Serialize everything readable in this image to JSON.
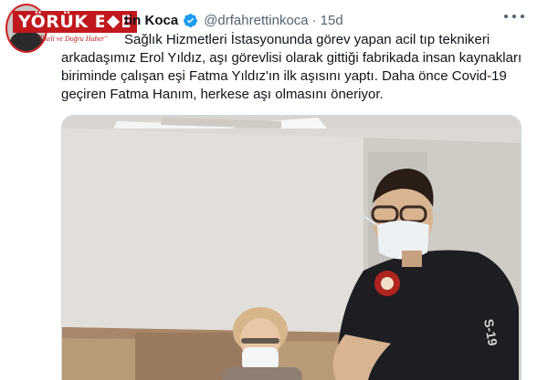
{
  "tweet": {
    "author_name": "tin Koca",
    "handle": "@drfahrettinkoca",
    "separator": "·",
    "time": "15d",
    "text_lines": [
      "Sağlık Hizmetleri İstasyonunda görev yapan acil tıp teknikeri",
      "arkadaşımız Erol Yıldız, aşı görevlisi olarak gittiği fabrikada insan kaynakları",
      "biriminde çalışan eşi Fatma Yıldız'ın ilk aşısını yaptı. Daha önce Covid-19",
      "geçiren Fatma Hanım, herkese aşı olmasını öneriyor."
    ],
    "verified_icon": "verified-badge-icon",
    "more_icon": "more-options-icon"
  },
  "watermark": {
    "title": "YÖRÜK EFE",
    "slogan": "\"İlkeli ve Doğru Haber\""
  },
  "colors": {
    "verified": "#1d9bf0",
    "secondary_text": "#536471",
    "watermark_red": "#c0181d",
    "photo_border": "#cfd9de"
  },
  "photo": {
    "uniform_text": "S-19",
    "description_icon": "tweet-photo"
  }
}
